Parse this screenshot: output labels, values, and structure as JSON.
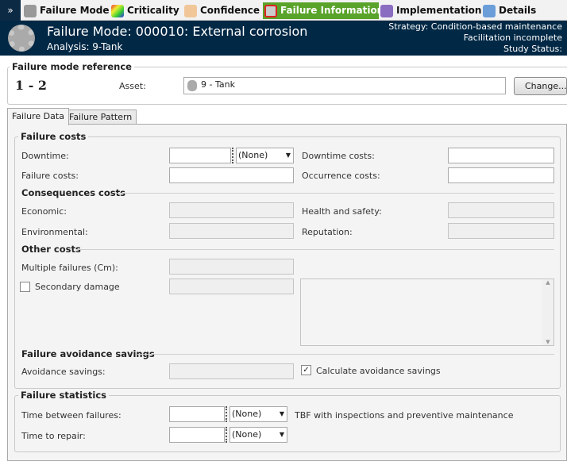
{
  "toolbar": {
    "tabs": [
      {
        "label": "Failure Mode",
        "icon": "failure-mode-icon",
        "active": false
      },
      {
        "label": "Criticality",
        "icon": "criticality-icon",
        "active": false
      },
      {
        "label": "Confidence",
        "icon": "thumbs-up-icon",
        "active": false
      },
      {
        "label": "Failure Information",
        "icon": "failure-information-icon",
        "active": true
      },
      {
        "label": "Implementation",
        "icon": "implementation-icon",
        "active": false
      },
      {
        "label": "Details",
        "icon": "details-icon",
        "active": false
      }
    ],
    "collapse": "»"
  },
  "header": {
    "title": "Failure Mode: 000010: External corrosion",
    "analysis": "Analysis: 9-Tank",
    "strategy": "Strategy: Condition-based maintenance",
    "facilitation": "Facilitation incomplete",
    "study_status": "Study Status:"
  },
  "reference": {
    "group": "Failure mode reference",
    "number": "1 - 2",
    "asset_label": "Asset:",
    "asset_value": "9 - Tank",
    "change": "Change..."
  },
  "tabs": {
    "failure_data": "Failure Data",
    "failure_pattern": "Failure Pattern"
  },
  "costs": {
    "group": "Failure costs",
    "downtime": "Downtime:",
    "downtime_unit": "(None)",
    "downtime_costs": "Downtime costs:",
    "failure_costs": "Failure costs:",
    "occurrence_costs": "Occurrence costs:",
    "consequences": "Consequences costs",
    "economic": "Economic:",
    "health": "Health and safety:",
    "environmental": "Environmental:",
    "reputation": "Reputation:",
    "other": "Other costs",
    "multiple": "Multiple failures (Cm):",
    "secondary": "Secondary damage",
    "secondary_checked": false,
    "avoidance_section": "Failure avoidance savings",
    "avoidance": "Avoidance savings:",
    "calc_avoidance": "Calculate avoidance savings",
    "calc_checked": true
  },
  "statistics": {
    "group": "Failure statistics",
    "tbf": "Time between failures:",
    "tbf_unit": "(None)",
    "tbf_note": "TBF with inspections and preventive maintenance",
    "ttr": "Time to repair:",
    "ttr_unit": "(None)"
  },
  "colors": {
    "header": "#012845",
    "active_tab": "#5aa32a"
  }
}
